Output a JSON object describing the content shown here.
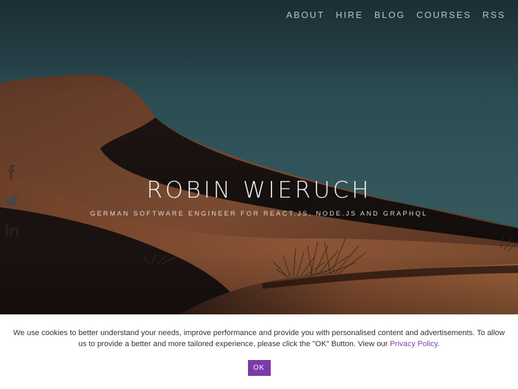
{
  "nav": {
    "items": [
      "ABOUT",
      "HIRE",
      "BLOG",
      "COURSES",
      "RSS"
    ]
  },
  "social": {
    "icons": [
      "facebook-icon",
      "twitter-icon",
      "linkedin-icon"
    ]
  },
  "hero": {
    "title": "ROBIN WIERUCH",
    "subtitle": "GERMAN SOFTWARE ENGINEER FOR REACT.JS, NODE.JS AND GRAPHQL"
  },
  "cookie": {
    "text_before": "We use cookies to better understand your needs, improve performance and provide you with personalised content and advertisements. To allow us to provide a better and more tailored experience, please click the \"OK\" Button. View our ",
    "link_label": "Privacy Policy",
    "text_after": ".",
    "ok_label": "OK"
  },
  "colors": {
    "sky": "#2d4f55",
    "dune": "#8a5535",
    "accent": "#7b3aaa"
  }
}
